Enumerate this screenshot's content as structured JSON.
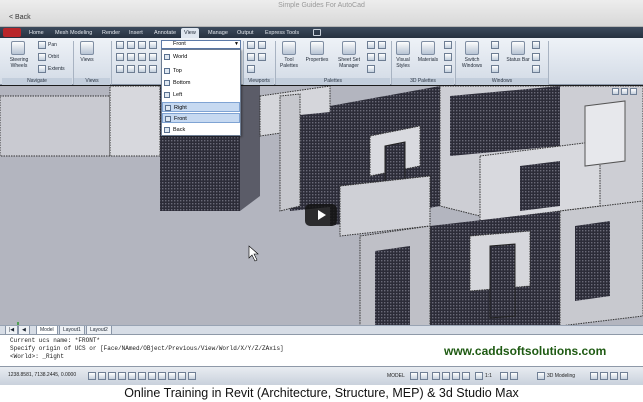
{
  "app": {
    "window_title": "Simple Guides For AutoCad",
    "back_label": "< Back"
  },
  "ribbon": {
    "tabs": [
      "Home",
      "Mesh Modeling",
      "Render",
      "Insert",
      "Annotate",
      "View",
      "Manage",
      "Output",
      "Express Tools"
    ],
    "active_tab": "View",
    "navigate": {
      "title": "Navigate",
      "steering_wheels": "Steering Wheels",
      "pan": "Pan",
      "orbit": "Orbit",
      "extents": "Extents"
    },
    "views": {
      "title": "Views",
      "views_button": "Views"
    },
    "ucs_combo": {
      "value": "Front"
    },
    "ucs_options": [
      "World",
      "Top",
      "Bottom",
      "Left",
      "Right",
      "Front",
      "Back"
    ],
    "ucs_selected": "Front",
    "viewports": {
      "title": "Viewports"
    },
    "palettes": {
      "title": "Palettes",
      "tool_palettes": "Tool Palettes",
      "properties": "Properties",
      "sheet_set_manager": "Sheet Set Manager"
    },
    "palettes_3d": {
      "title": "3D Palettes",
      "visual_styles": "Visual Styles",
      "materials": "Materials"
    },
    "windows": {
      "title": "Windows",
      "switch_windows": "Switch Windows",
      "status_bar": "Status Bar"
    }
  },
  "layout_tabs": [
    "Model",
    "Layout1",
    "Layout2"
  ],
  "layout_active": "Model",
  "command_line": {
    "lines": [
      "Current ucs name:  *FRONT*",
      "Specify origin of UCS or [Face/NAmed/OBject/Previous/View/World/X/Y/Z/ZAxis]",
      "<World>: _Right"
    ]
  },
  "watermark": "www.caddsoftsolutions.com",
  "status_bar": {
    "coordinates": "1238.8581, 7138.2445, 0.0000",
    "model_label": "MODEL",
    "scale": "1:1",
    "workspace": "3D Modeling"
  },
  "caption": "Online Training in Revit (Architecture, Structure, MEP) & 3d Studio Max",
  "colors": {
    "tab_strip": "#26313f",
    "viewport_bg": "#b5b7c1",
    "building_face": "#d6d6d8",
    "building_dark": "#2b2b36",
    "watermark": "#1e5a12"
  }
}
